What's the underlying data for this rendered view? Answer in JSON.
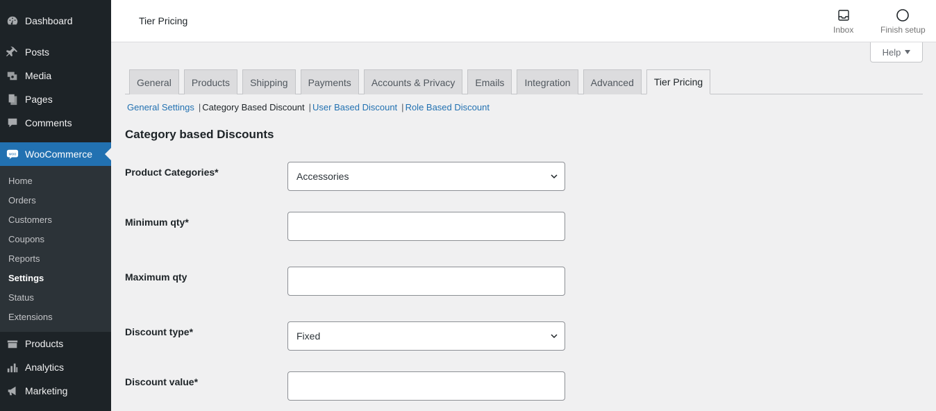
{
  "sidebar": {
    "items_top": [
      {
        "label": "Dashboard",
        "icon": "dashboard-icon"
      },
      {
        "label": "Posts",
        "icon": "pin-icon"
      },
      {
        "label": "Media",
        "icon": "media-icon"
      },
      {
        "label": "Pages",
        "icon": "pages-icon"
      },
      {
        "label": "Comments",
        "icon": "comment-icon"
      },
      {
        "label": "WooCommerce",
        "icon": "woo-icon"
      }
    ],
    "submenu": [
      "Home",
      "Orders",
      "Customers",
      "Coupons",
      "Reports",
      "Settings",
      "Status",
      "Extensions"
    ],
    "items_bottom": [
      {
        "label": "Products",
        "icon": "products-icon"
      },
      {
        "label": "Analytics",
        "icon": "chart-icon"
      },
      {
        "label": "Marketing",
        "icon": "megaphone-icon"
      }
    ]
  },
  "header": {
    "title": "Tier Pricing",
    "inbox_label": "Inbox",
    "finish_setup_label": "Finish setup",
    "help_label": "Help"
  },
  "tabs": [
    "General",
    "Products",
    "Shipping",
    "Payments",
    "Accounts & Privacy",
    "Emails",
    "Integration",
    "Advanced",
    "Tier Pricing"
  ],
  "subnav": {
    "general_settings": "General Settings",
    "category_based": "Category Based Discount",
    "user_based": "User Based Discount",
    "role_based": "Role Based Discount",
    "separator": "|"
  },
  "section_title": "Category based Discounts",
  "form": {
    "product_categories": {
      "label": "Product Categories*",
      "value": "Accessories"
    },
    "minimum_qty": {
      "label": "Minimum qty*",
      "value": ""
    },
    "maximum_qty": {
      "label": "Maximum qty",
      "value": ""
    },
    "discount_type": {
      "label": "Discount type*",
      "value": "Fixed"
    },
    "discount_value": {
      "label": "Discount value*",
      "value": ""
    }
  },
  "colors": {
    "sidebar_bg": "#1d2327",
    "accent": "#2271b1",
    "link": "#2271b1"
  }
}
